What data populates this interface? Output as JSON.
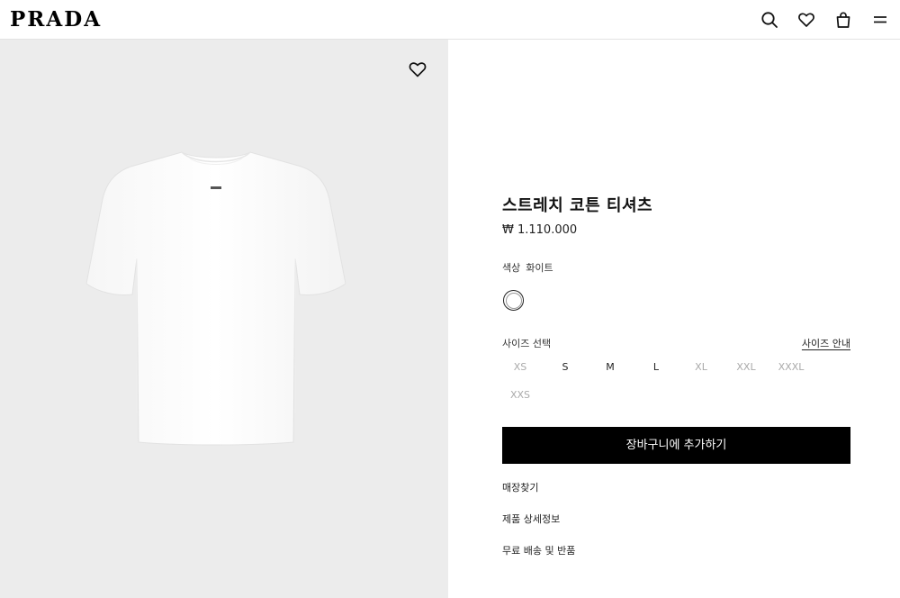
{
  "header": {
    "logo": "PRADA",
    "icons": [
      "search-icon",
      "heart-icon",
      "bag-icon",
      "menu-icon"
    ]
  },
  "gallery": {
    "background": "#ececec",
    "wishlist_icon": "heart-icon"
  },
  "product": {
    "title": "스트레치 코튼 티셔츠",
    "price": "₩ 1.110.000",
    "color_label": "색상",
    "color_value": "화이트",
    "size_label": "사이즈 선택",
    "size_guide": "사이즈 안내",
    "sizes": [
      {
        "label": "XS",
        "available": false
      },
      {
        "label": "S",
        "available": true
      },
      {
        "label": "M",
        "available": true
      },
      {
        "label": "L",
        "available": true
      },
      {
        "label": "XL",
        "available": false
      },
      {
        "label": "XXL",
        "available": false
      },
      {
        "label": "XXXL",
        "available": false
      },
      {
        "label": "XXS",
        "available": false
      }
    ],
    "add_to_cart": "장바구니에 추가하기",
    "links": [
      "매장찾기",
      "제품 상세정보",
      "무료 배송 및 반품"
    ]
  },
  "colors": {
    "primary_button": "#000000",
    "available_size": "#222222",
    "unavailable_size": "#aaaaaa"
  }
}
